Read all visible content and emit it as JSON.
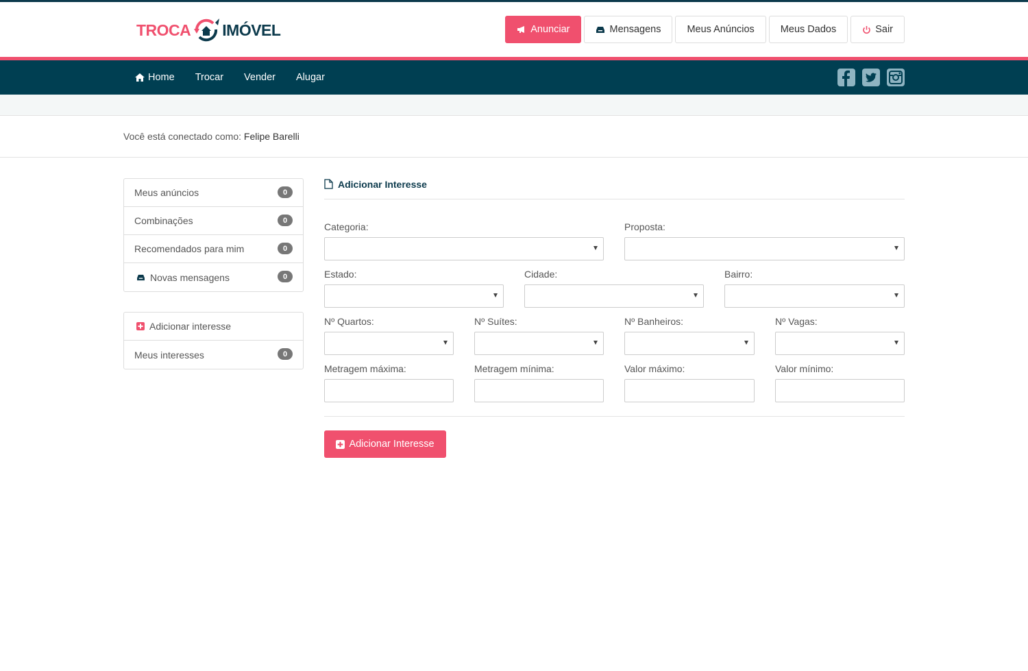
{
  "brand": {
    "word1": "TROCA",
    "word2": "IMÓVEL"
  },
  "top_actions": {
    "anunciar": "Anunciar",
    "mensagens": "Mensagens",
    "meus_anuncios": "Meus Anúncios",
    "meus_dados": "Meus Dados",
    "sair": "Sair"
  },
  "nav": {
    "home": "Home",
    "trocar": "Trocar",
    "vender": "Vender",
    "alugar": "Alugar",
    "social_icons": [
      "facebook-icon",
      "twitter-icon",
      "instagram-icon"
    ]
  },
  "user": {
    "prefix": "Você está conectado como:",
    "name": "Felipe Barelli"
  },
  "sidebar": {
    "group1": [
      {
        "label": "Meus anúncios",
        "count": "0"
      },
      {
        "label": "Combinações",
        "count": "0"
      },
      {
        "label": "Recomendados para mim",
        "count": "0"
      },
      {
        "label": "Novas mensagens",
        "count": "0",
        "icon": "inbox-icon"
      }
    ],
    "group2": [
      {
        "label": "Adicionar interesse",
        "icon": "plus-square-icon"
      },
      {
        "label": "Meus interesses",
        "count": "0"
      }
    ]
  },
  "form": {
    "title": "Adicionar Interesse",
    "categoria": {
      "label": "Categoria:",
      "value": ""
    },
    "proposta": {
      "label": "Proposta:",
      "value": ""
    },
    "estado": {
      "label": "Estado:",
      "value": ""
    },
    "cidade": {
      "label": "Cidade:",
      "value": ""
    },
    "bairro": {
      "label": "Bairro:",
      "value": ""
    },
    "quartos": {
      "label": "Nº Quartos:",
      "value": ""
    },
    "suites": {
      "label": "Nº Suítes:",
      "value": ""
    },
    "banheiros": {
      "label": "Nº Banheiros:",
      "value": ""
    },
    "vagas": {
      "label": "Nº Vagas:",
      "value": ""
    },
    "metragem_max": {
      "label": "Metragem máxima:",
      "value": ""
    },
    "metragem_min": {
      "label": "Metragem mínima:",
      "value": ""
    },
    "valor_max": {
      "label": "Valor máximo:",
      "value": ""
    },
    "valor_min": {
      "label": "Valor mínimo:",
      "value": ""
    },
    "submit": "Adicionar Interesse"
  },
  "colors": {
    "accent": "#f0506e",
    "navy": "#003f52",
    "brand_dark": "#0c3a4c"
  }
}
